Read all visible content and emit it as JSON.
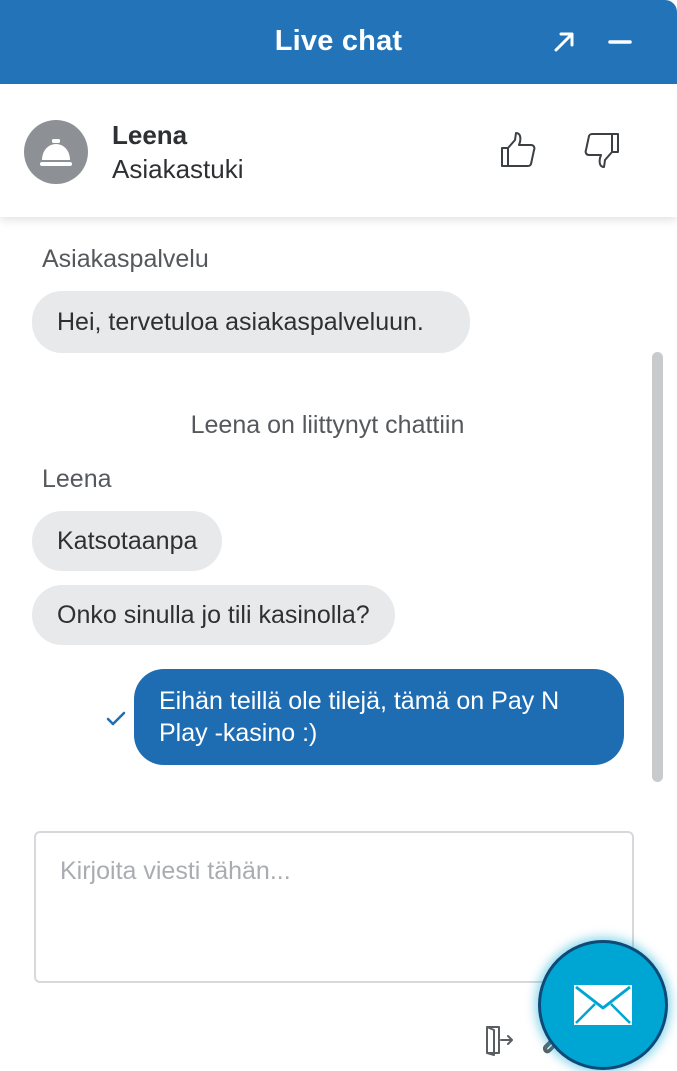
{
  "header": {
    "title": "Live chat",
    "expand_icon": "arrow-expand-icon",
    "minimize_icon": "minimize-icon",
    "background_color": "#2273b8"
  },
  "agent": {
    "name": "Leena",
    "role": "Asiakastuki",
    "avatar_icon": "service-bell-icon",
    "rate_up_icon": "thumbs-up-icon",
    "rate_down_icon": "thumbs-down-icon"
  },
  "messages": [
    {
      "type": "incoming",
      "sender": "Asiakaspalvelu",
      "text": "Hei, tervetuloa asiakaspalveluun."
    },
    {
      "type": "system",
      "text": "Leena on liittynyt chattiin"
    },
    {
      "type": "incoming",
      "sender": "Leena",
      "text": "Katsotaanpa"
    },
    {
      "type": "incoming",
      "sender": "",
      "text": "Onko sinulla jo tili kasinolla?"
    },
    {
      "type": "outgoing",
      "text": "Eihän teillä ole tilejä, tämä on Pay N Play -kasino :)",
      "status_icon": "checkmark-icon"
    }
  ],
  "composer": {
    "placeholder": "Kirjoita viesti tähän...",
    "value": ""
  },
  "toolbar": {
    "exit_icon": "exit-icon",
    "attach_icon": "attachment-icon"
  },
  "send_button": {
    "icon": "envelope-icon",
    "color": "#00a6d3"
  },
  "colors": {
    "incoming_bubble": "#e8e9eb",
    "outgoing_bubble": "#1e6db3"
  }
}
